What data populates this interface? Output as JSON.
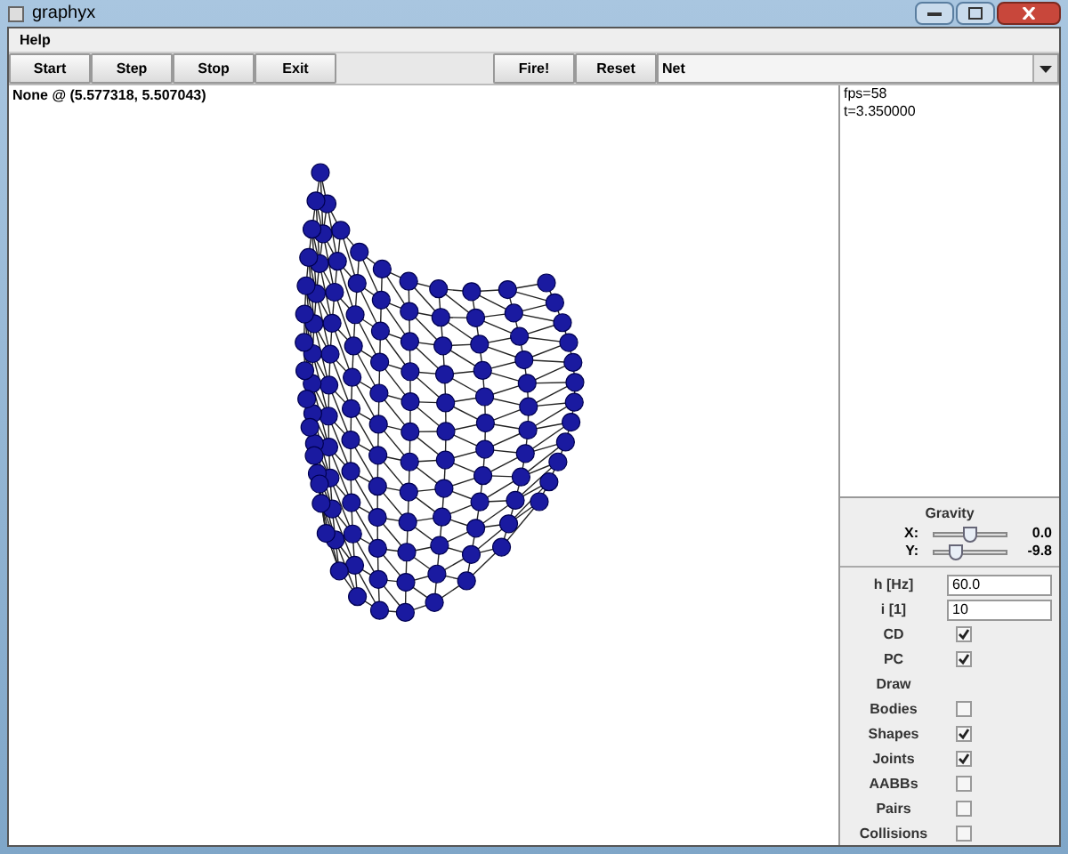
{
  "window": {
    "title": "graphyx"
  },
  "menu": [
    "Help"
  ],
  "toolbar": {
    "buttons_left": [
      "Start",
      "Step",
      "Stop",
      "Exit"
    ],
    "buttons_right": [
      "Fire!",
      "Reset"
    ],
    "scene_select": {
      "value": "Net"
    }
  },
  "status": "None @ (5.577318, 5.507043)",
  "info": [
    "fps=58",
    "t=3.350000"
  ],
  "gravity": {
    "title": "Gravity",
    "sliders": [
      {
        "label": "X:",
        "level": 0.5,
        "reading": "0.0"
      },
      {
        "label": "Y:",
        "level": 0.3,
        "reading": "-9.8"
      }
    ]
  },
  "settings": [
    {
      "kind": "field",
      "label": "h [Hz]",
      "value": "60.0"
    },
    {
      "kind": "field",
      "label": "i [1]",
      "value": "10"
    },
    {
      "kind": "check",
      "label": "CD",
      "checked": true
    },
    {
      "kind": "check",
      "label": "PC",
      "checked": true
    },
    {
      "kind": "heading",
      "label": "Draw"
    },
    {
      "kind": "check",
      "label": "Bodies",
      "checked": false
    },
    {
      "kind": "check",
      "label": "Shapes",
      "checked": true
    },
    {
      "kind": "check",
      "label": "Joints",
      "checked": true
    },
    {
      "kind": "check",
      "label": "AABBs",
      "checked": false
    },
    {
      "kind": "check",
      "label": "Pairs",
      "checked": false
    },
    {
      "kind": "check",
      "label": "Collisions",
      "checked": false
    }
  ]
}
